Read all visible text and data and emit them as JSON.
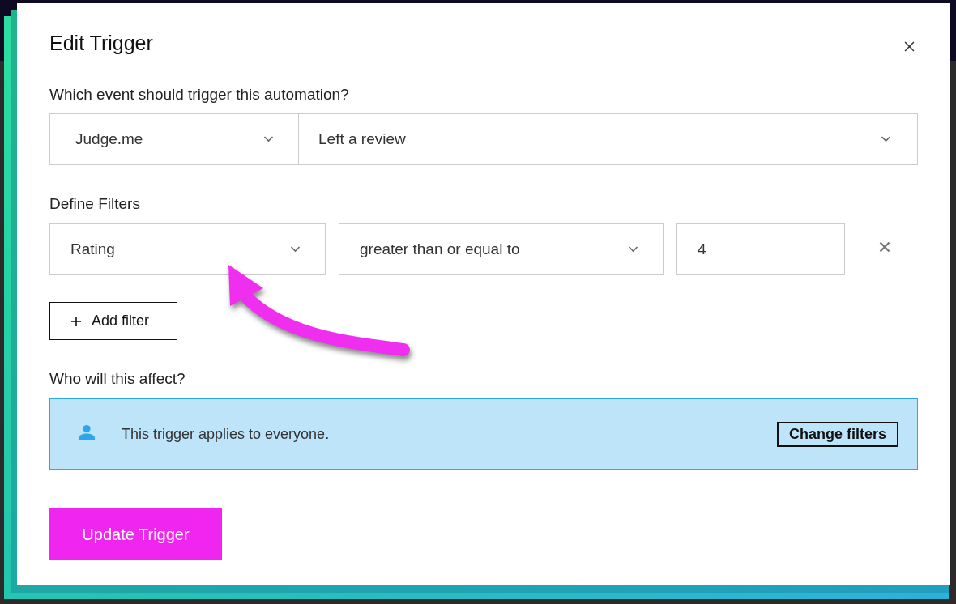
{
  "dialog": {
    "title": "Edit Trigger"
  },
  "trigger": {
    "label": "Which event should trigger this automation?",
    "selects": [
      {
        "value": "Judge.me"
      },
      {
        "value": "Left a review"
      }
    ]
  },
  "filters": {
    "label": "Define Filters",
    "rows": [
      {
        "field": "Rating",
        "operator": "greater than or equal to",
        "value": "4"
      }
    ],
    "add_button": "Add filter"
  },
  "audience": {
    "label": "Who will this affect?",
    "message": "This trigger applies to everyone.",
    "button": "Change filters"
  },
  "submit_button": "Update Trigger"
}
